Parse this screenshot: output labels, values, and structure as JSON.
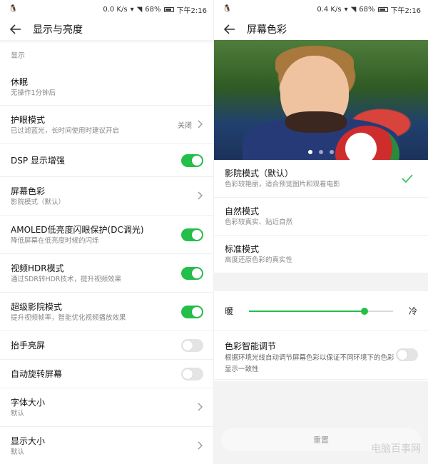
{
  "left": {
    "status": {
      "speed": "0.0 K/s",
      "battery": "68%",
      "time": "下午2:16"
    },
    "title": "显示与亮度",
    "section": "显示",
    "rows": [
      {
        "title": "休眠",
        "subtitle": "无操作1分钟后",
        "control": "none"
      },
      {
        "title": "护眼模式",
        "subtitle": "已过滤蓝光，长时间使用时建议开启",
        "value": "关闭",
        "control": "chevron"
      },
      {
        "title": "DSP 显示增强",
        "subtitle": "",
        "control": "toggle",
        "on": true
      },
      {
        "title": "屏幕色彩",
        "subtitle": "影院模式（默认）",
        "control": "chevron"
      },
      {
        "title": "AMOLED低亮度闪眼保护(DC调光)",
        "subtitle": "降低屏幕在低亮度时候的闪烁",
        "control": "toggle",
        "on": true
      },
      {
        "title": "视频HDR模式",
        "subtitle": "通过SDR转HDR技术，提升视频效果",
        "control": "toggle",
        "on": true
      },
      {
        "title": "超级影院模式",
        "subtitle": "提升视频帧率，智能优化视频播放效果",
        "control": "toggle",
        "on": true
      },
      {
        "title": "抬手亮屏",
        "subtitle": "",
        "control": "toggle",
        "on": false
      },
      {
        "title": "自动旋转屏幕",
        "subtitle": "",
        "control": "toggle",
        "on": false
      },
      {
        "title": "字体大小",
        "subtitle": "默认",
        "control": "chevron"
      },
      {
        "title": "显示大小",
        "subtitle": "默认",
        "control": "chevron"
      }
    ]
  },
  "right": {
    "status": {
      "speed": "0.4 K/s",
      "battery": "68%",
      "time": "下午2:16"
    },
    "title": "屏幕色彩",
    "carousel": {
      "count": 3,
      "active": 0
    },
    "modes": [
      {
        "title": "影院模式（默认）",
        "subtitle": "色彩较艳丽，适合预览图片和观看电影",
        "selected": true
      },
      {
        "title": "自然模式",
        "subtitle": "色彩较真实、贴近自然",
        "selected": false
      },
      {
        "title": "标准模式",
        "subtitle": "高度还原色彩的真实性",
        "selected": false
      }
    ],
    "temperature": {
      "warm_label": "暖",
      "cold_label": "冷",
      "value": 0.8
    },
    "smart": {
      "title": "色彩智能调节",
      "subtitle": "根据环境光线自动调节屏幕色彩以保证不同环境下的色彩显示一致性",
      "on": false
    },
    "reset_label": "重置",
    "watermark": "电脑百事网"
  },
  "colors": {
    "accent": "#24bf4a"
  }
}
